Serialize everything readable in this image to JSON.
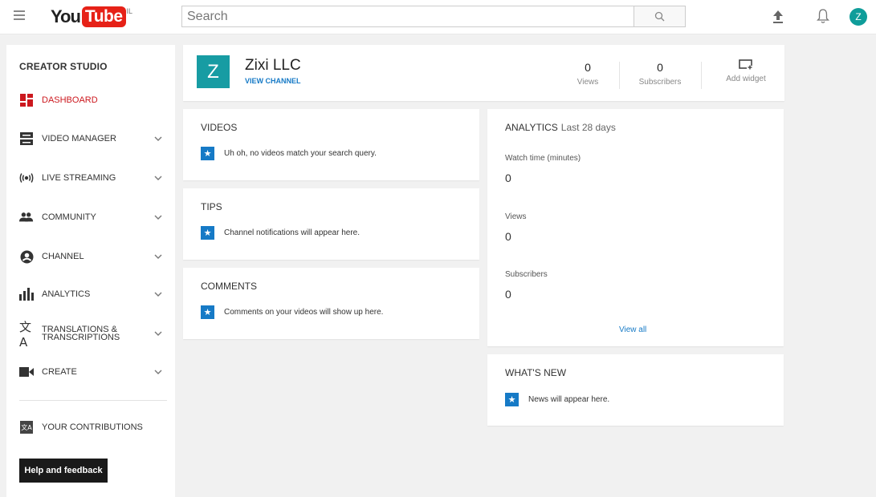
{
  "header": {
    "logo_you": "You",
    "logo_tube": "Tube",
    "logo_country": "IL",
    "search_placeholder": "Search",
    "avatar_letter": "Z"
  },
  "sidebar": {
    "title": "CREATOR STUDIO",
    "items": [
      {
        "label": "DASHBOARD",
        "icon": "dashboard-icon"
      },
      {
        "label": "VIDEO MANAGER",
        "icon": "video-manager-icon"
      },
      {
        "label": "LIVE STREAMING",
        "icon": "live-streaming-icon"
      },
      {
        "label": "COMMUNITY",
        "icon": "community-icon"
      },
      {
        "label": "CHANNEL",
        "icon": "channel-icon"
      },
      {
        "label": "ANALYTICS",
        "icon": "analytics-icon"
      },
      {
        "label_line1": "TRANSLATIONS &",
        "label_line2": "TRANSCRIPTIONS",
        "icon": "translations-icon"
      },
      {
        "label": "CREATE",
        "icon": "create-icon"
      }
    ],
    "contributions": "YOUR CONTRIBUTIONS",
    "help_button": "Help and feedback"
  },
  "channel": {
    "avatar_letter": "Z",
    "name": "Zixi LLC",
    "view_channel": "VIEW CHANNEL",
    "views_value": "0",
    "views_label": "Views",
    "subscribers_value": "0",
    "subscribers_label": "Subscribers",
    "add_widget": "Add widget"
  },
  "videos": {
    "title": "VIDEOS",
    "message": "Uh oh, no videos match your search query."
  },
  "tips": {
    "title": "TIPS",
    "message": "Channel notifications will appear here."
  },
  "comments": {
    "title": "COMMENTS",
    "message": "Comments on your videos will show up here."
  },
  "analytics": {
    "title": "ANALYTICS",
    "period": "Last 28 days",
    "watch_time_label": "Watch time (minutes)",
    "watch_time_value": "0",
    "views_label": "Views",
    "views_value": "0",
    "subscribers_label": "Subscribers",
    "subscribers_value": "0",
    "view_all": "View all"
  },
  "whats_new": {
    "title": "WHAT'S NEW",
    "message": "News will appear here."
  },
  "colors": {
    "brand_red": "#e62117",
    "link_blue": "#167ac6",
    "avatar_teal": "#179ca3",
    "active_red": "#cc181e"
  }
}
